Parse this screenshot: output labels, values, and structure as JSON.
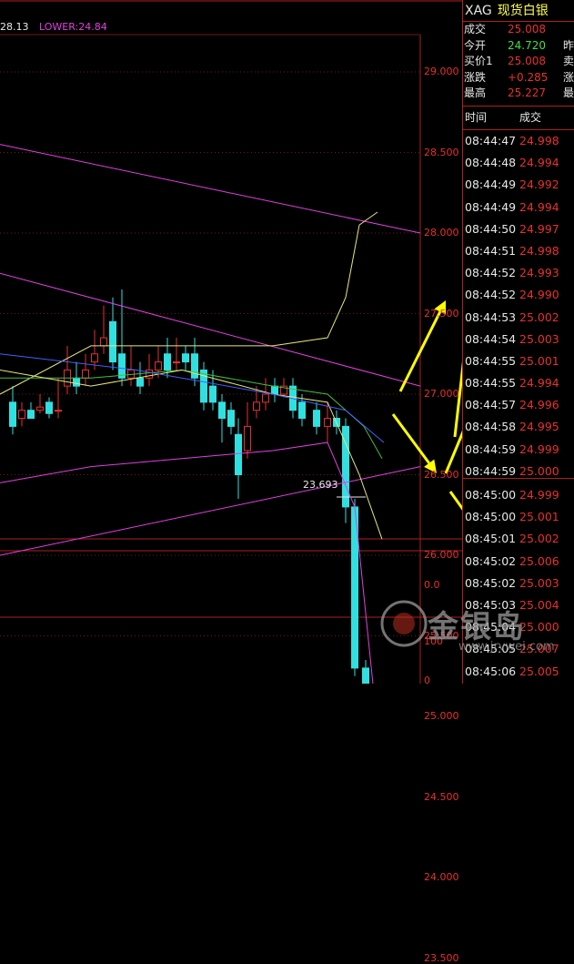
{
  "bollinger": {
    "upper": "28.13",
    "lower_label": "LOWER:",
    "lower": "24.84"
  },
  "price_axis": [
    "29.000",
    "28.500",
    "28.000",
    "27.500",
    "27.000",
    "26.500",
    "26.000",
    "25.500",
    "25.000",
    "24.500",
    "24.000",
    "23.500"
  ],
  "low_annotation": "23.693",
  "indicator_axis": {
    "macd_zero": "0.0",
    "kdj_top": "100",
    "kdj_bottom": "0"
  },
  "instrument": {
    "code": "XAG",
    "name": "现货白银"
  },
  "quote": [
    {
      "label": "成交",
      "value": "25.008",
      "edge": "",
      "color": "red"
    },
    {
      "label": "今开",
      "value": "24.720",
      "edge": "昨",
      "color": "green"
    },
    {
      "label": "买价1",
      "value": "25.008",
      "edge": "卖",
      "color": "red"
    },
    {
      "label": "涨跌",
      "value": "+0.285",
      "edge": "涨",
      "color": "red"
    },
    {
      "label": "最高",
      "value": "25.227",
      "edge": "最",
      "color": "red"
    }
  ],
  "trades_header": {
    "time": "时间",
    "price": "成交"
  },
  "trades": [
    {
      "time": "08:44:47",
      "price": "24.998"
    },
    {
      "time": "08:44:48",
      "price": "24.994"
    },
    {
      "time": "08:44:49",
      "price": "24.992"
    },
    {
      "time": "08:44:49",
      "price": "24.994"
    },
    {
      "time": "08:44:50",
      "price": "24.997"
    },
    {
      "time": "08:44:51",
      "price": "24.998"
    },
    {
      "time": "08:44:52",
      "price": "24.993"
    },
    {
      "time": "08:44:52",
      "price": "24.990"
    },
    {
      "time": "08:44:53",
      "price": "25.002"
    },
    {
      "time": "08:44:54",
      "price": "25.003"
    },
    {
      "time": "08:44:55",
      "price": "25.001"
    },
    {
      "time": "08:44:55",
      "price": "24.994"
    },
    {
      "time": "08:44:57",
      "price": "24.996"
    },
    {
      "time": "08:44:58",
      "price": "24.995"
    },
    {
      "time": "08:44:59",
      "price": "24.999"
    },
    {
      "time": "08:44:59",
      "price": "25.000"
    },
    {
      "time": "08:45:00",
      "price": "24.999"
    },
    {
      "time": "08:45:00",
      "price": "25.001"
    },
    {
      "time": "08:45:01",
      "price": "25.002"
    },
    {
      "time": "08:45:02",
      "price": "25.006"
    },
    {
      "time": "08:45:02",
      "price": "25.003"
    },
    {
      "time": "08:45:03",
      "price": "25.004"
    },
    {
      "time": "08:45:04",
      "price": "25.000"
    },
    {
      "time": "08:45:05",
      "price": "25.007"
    },
    {
      "time": "08:45:06",
      "price": "25.005"
    }
  ],
  "watermark": {
    "brand": "金银岛",
    "url": "www.jrvwei.com"
  },
  "colors": {
    "up": "#e83030",
    "down": "#30e0e0",
    "accent": "#ffff00",
    "grid": "#b02020"
  }
}
